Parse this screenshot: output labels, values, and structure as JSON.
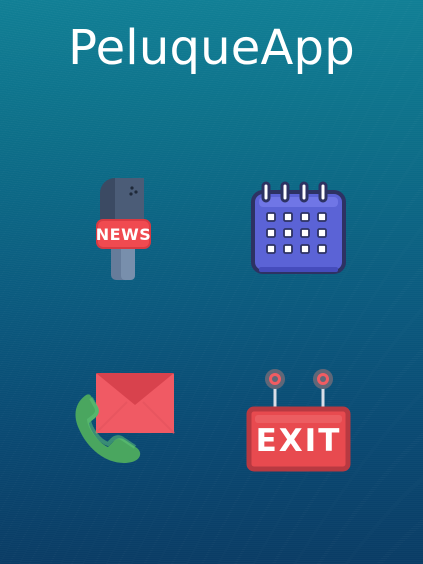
{
  "app": {
    "title": "PeluqueApp"
  },
  "tiles": [
    {
      "id": "news",
      "label": "NEWS",
      "icon": "news-microphone-icon"
    },
    {
      "id": "calendar",
      "icon": "calendar-icon"
    },
    {
      "id": "contact",
      "icon": "phone-mail-icon"
    },
    {
      "id": "exit",
      "label": "EXIT",
      "icon": "exit-sign-icon"
    }
  ],
  "colors": {
    "background_top": "#117f95",
    "background_bottom": "#0a3c65",
    "news_red": "#f04a50",
    "calendar_purple": "#5b63d6",
    "calendar_outline": "#2d3263",
    "phone_green": "#4aa65f",
    "mail_red": "#f05a64",
    "exit_red": "#e84a4f",
    "exit_border": "#b83941"
  }
}
